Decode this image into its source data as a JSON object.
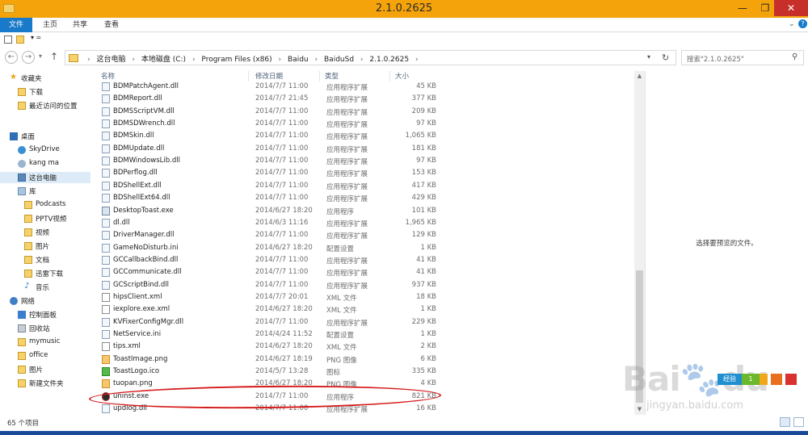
{
  "window": {
    "title": "2.1.0.2625",
    "minimize": "—",
    "maximize": "❐",
    "close": "✕"
  },
  "ribbon": {
    "tabs": [
      "文件",
      "主页",
      "共享",
      "查看"
    ],
    "expand": "⌄",
    "help": "?"
  },
  "quick_access": {
    "dropdown": "▾ ="
  },
  "nav": {
    "back": "←",
    "forward": "→",
    "history": "▾",
    "up": "↑",
    "breadcrumbs": [
      "这台电脑",
      "本地磁盘 (C:)",
      "Program Files (x86)",
      "Baidu",
      "BaiduSd",
      "2.1.0.2625"
    ],
    "address_dropdown": "▾",
    "refresh": "↻",
    "search_placeholder": "搜索\"2.1.0.2625\"",
    "search_icon": "⚲"
  },
  "sidebar": {
    "items": [
      {
        "label": "收藏夹",
        "icon": "star-icon"
      },
      {
        "label": "下载",
        "icon": "folder-icon"
      },
      {
        "label": "最近访问的位置",
        "icon": "folder-icon"
      },
      {
        "label": "桌面",
        "icon": "desktop-icon"
      },
      {
        "label": "SkyDrive",
        "icon": "cloud-icon"
      },
      {
        "label": "kang ma",
        "icon": "user-icon"
      },
      {
        "label": "这台电脑",
        "icon": "computer-icon"
      },
      {
        "label": "库",
        "icon": "library-icon"
      },
      {
        "label": "Podcasts",
        "icon": "folder-icon"
      },
      {
        "label": "PPTV视频",
        "icon": "folder-icon"
      },
      {
        "label": "视频",
        "icon": "folder-icon"
      },
      {
        "label": "图片",
        "icon": "folder-icon"
      },
      {
        "label": "文档",
        "icon": "folder-icon"
      },
      {
        "label": "迅雷下载",
        "icon": "folder-icon"
      },
      {
        "label": "音乐",
        "icon": "music-icon"
      },
      {
        "label": "网络",
        "icon": "network-icon"
      },
      {
        "label": "控制面板",
        "icon": "control-panel-icon"
      },
      {
        "label": "回收站",
        "icon": "recycle-bin-icon"
      },
      {
        "label": "mymusic",
        "icon": "folder-icon"
      },
      {
        "label": "office",
        "icon": "folder-icon"
      },
      {
        "label": "图片",
        "icon": "folder-icon"
      },
      {
        "label": "新建文件夹",
        "icon": "folder-icon"
      }
    ]
  },
  "filelist": {
    "columns": {
      "name": "名称",
      "date": "修改日期",
      "type": "类型",
      "size": "大小"
    },
    "rows": [
      {
        "name": "BDMPatchAgent.dll",
        "date": "2014/7/7 11:00",
        "type": "应用程序扩展",
        "size": "45 KB",
        "kind": "dll"
      },
      {
        "name": "BDMReport.dll",
        "date": "2014/7/7 21:45",
        "type": "应用程序扩展",
        "size": "377 KB",
        "kind": "dll"
      },
      {
        "name": "BDMSScriptVM.dll",
        "date": "2014/7/7 11:00",
        "type": "应用程序扩展",
        "size": "209 KB",
        "kind": "dll"
      },
      {
        "name": "BDMSDWrench.dll",
        "date": "2014/7/7 11:00",
        "type": "应用程序扩展",
        "size": "97 KB",
        "kind": "dll"
      },
      {
        "name": "BDMSkin.dll",
        "date": "2014/7/7 11:00",
        "type": "应用程序扩展",
        "size": "1,065 KB",
        "kind": "dll"
      },
      {
        "name": "BDMUpdate.dll",
        "date": "2014/7/7 11:00",
        "type": "应用程序扩展",
        "size": "181 KB",
        "kind": "dll"
      },
      {
        "name": "BDMWindowsLib.dll",
        "date": "2014/7/7 11:00",
        "type": "应用程序扩展",
        "size": "97 KB",
        "kind": "dll"
      },
      {
        "name": "BDPerflog.dll",
        "date": "2014/7/7 11:00",
        "type": "应用程序扩展",
        "size": "153 KB",
        "kind": "dll"
      },
      {
        "name": "BDShellExt.dll",
        "date": "2014/7/7 11:00",
        "type": "应用程序扩展",
        "size": "417 KB",
        "kind": "dll"
      },
      {
        "name": "BDShellExt64.dll",
        "date": "2014/7/7 11:00",
        "type": "应用程序扩展",
        "size": "429 KB",
        "kind": "dll"
      },
      {
        "name": "DesktopToast.exe",
        "date": "2014/6/27 18:20",
        "type": "应用程序",
        "size": "101 KB",
        "kind": "exe"
      },
      {
        "name": "dl.dll",
        "date": "2014/6/3 11:16",
        "type": "应用程序扩展",
        "size": "1,965 KB",
        "kind": "dll"
      },
      {
        "name": "DriverManager.dll",
        "date": "2014/7/7 11:00",
        "type": "应用程序扩展",
        "size": "129 KB",
        "kind": "dll"
      },
      {
        "name": "GameNoDisturb.ini",
        "date": "2014/6/27 18:20",
        "type": "配置设置",
        "size": "1 KB",
        "kind": "ini"
      },
      {
        "name": "GCCallbackBind.dll",
        "date": "2014/7/7 11:00",
        "type": "应用程序扩展",
        "size": "41 KB",
        "kind": "dll"
      },
      {
        "name": "GCCommunicate.dll",
        "date": "2014/7/7 11:00",
        "type": "应用程序扩展",
        "size": "41 KB",
        "kind": "dll"
      },
      {
        "name": "GCScriptBind.dll",
        "date": "2014/7/7 11:00",
        "type": "应用程序扩展",
        "size": "937 KB",
        "kind": "dll"
      },
      {
        "name": "hipsClient.xml",
        "date": "2014/7/7 20:01",
        "type": "XML 文件",
        "size": "18 KB",
        "kind": "xml"
      },
      {
        "name": "iexplore.exe.xml",
        "date": "2014/6/27 18:20",
        "type": "XML 文件",
        "size": "1 KB",
        "kind": "xml"
      },
      {
        "name": "KVFixerConfigMgr.dll",
        "date": "2014/7/7 11:00",
        "type": "应用程序扩展",
        "size": "229 KB",
        "kind": "dll"
      },
      {
        "name": "NetService.ini",
        "date": "2014/4/24 11:52",
        "type": "配置设置",
        "size": "1 KB",
        "kind": "ini"
      },
      {
        "name": "tips.xml",
        "date": "2014/6/27 18:20",
        "type": "XML 文件",
        "size": "2 KB",
        "kind": "xml"
      },
      {
        "name": "ToastImage.png",
        "date": "2014/6/27 18:19",
        "type": "PNG 图像",
        "size": "6 KB",
        "kind": "png"
      },
      {
        "name": "ToastLogo.ico",
        "date": "2014/5/7 13:28",
        "type": "图标",
        "size": "335 KB",
        "kind": "ico"
      },
      {
        "name": "tuopan.png",
        "date": "2014/6/27 18:20",
        "type": "PNG 图像",
        "size": "4 KB",
        "kind": "png"
      },
      {
        "name": "uninst.exe",
        "date": "2014/7/7 11:00",
        "type": "应用程序",
        "size": "821 KB",
        "kind": "uninst"
      },
      {
        "name": "updlog.dll",
        "date": "2014/7/7 11:00",
        "type": "应用程序扩展",
        "size": "16 KB",
        "kind": "dll"
      }
    ]
  },
  "scrollbar": {
    "up": "▲",
    "down": "▼"
  },
  "preview": {
    "message": "选择要预览的文件。"
  },
  "status": {
    "item_count": "65 个项目"
  },
  "watermark": {
    "brand": "Bai",
    "brand2": "du",
    "site": "jingyan.baidu.com",
    "badges": [
      "经验",
      "1",
      "",
      "",
      ""
    ]
  }
}
